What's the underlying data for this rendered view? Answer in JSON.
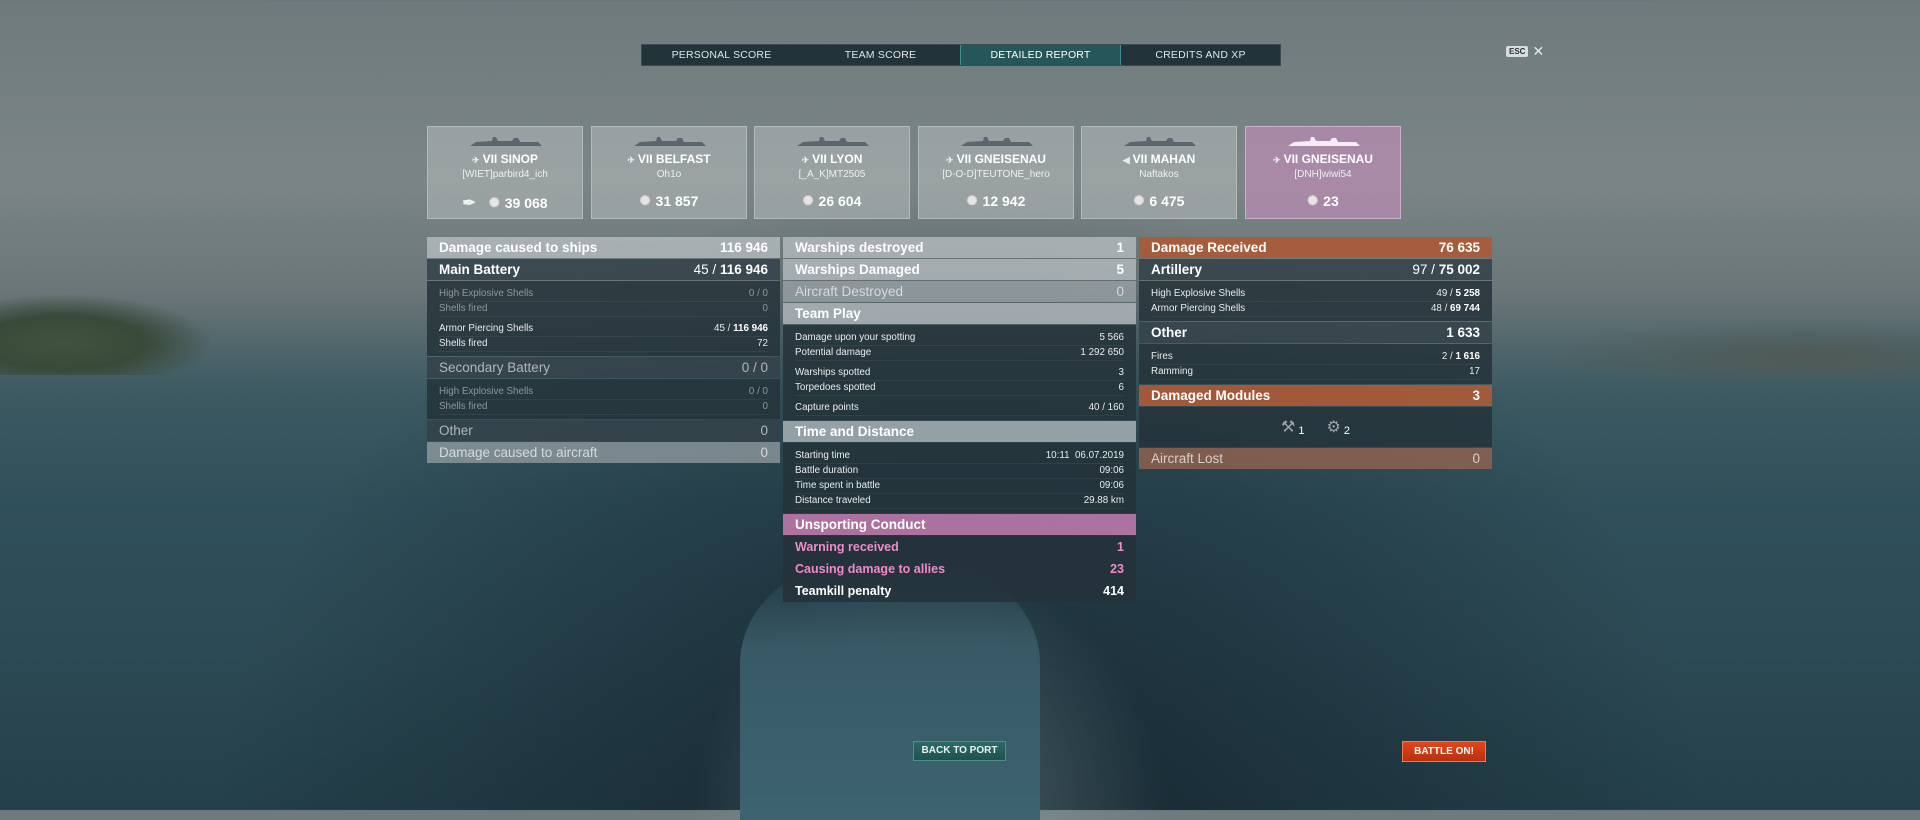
{
  "tabs": [
    {
      "label": "PERSONAL SCORE"
    },
    {
      "label": "TEAM SCORE"
    },
    {
      "label": "DETAILED REPORT"
    },
    {
      "label": "CREDITS AND XP"
    }
  ],
  "esc": {
    "key": "ESC",
    "close": "✕"
  },
  "ships": [
    {
      "tier_name": "VII SINOP",
      "player": "[WIET]parbird4_ich",
      "score": "39 068",
      "nation": "✈"
    },
    {
      "tier_name": "VII BELFAST",
      "player": "Oh1o",
      "score": "31 857",
      "nation": "✈"
    },
    {
      "tier_name": "VII LYON",
      "player": "[_A_K]MT2505",
      "score": "26 604",
      "nation": "✈"
    },
    {
      "tier_name": "VII GNEISENAU",
      "player": "[D-O-D]TEUTONE_hero",
      "score": "12 942",
      "nation": "✈"
    },
    {
      "tier_name": "VII MAHAN",
      "player": "Naftakos",
      "score": "6 475",
      "nation": "◀"
    },
    {
      "tier_name": "VII GNEISENAU",
      "player": "[DNH]wiwi54",
      "score": "23",
      "nation": "✈"
    }
  ],
  "left": {
    "damage_ships": {
      "label": "Damage caused to ships",
      "value": "116 946"
    },
    "main_battery": {
      "label": "Main Battery",
      "hits": "45 /",
      "value": "116 946"
    },
    "mb_he": {
      "label": "High Explosive Shells",
      "value": "0 / 0"
    },
    "mb_he_fired": {
      "label": "Shells fired",
      "value": "0"
    },
    "mb_ap": {
      "label": "Armor Piercing Shells",
      "hits": "45 /",
      "value": "116 946"
    },
    "mb_ap_fired": {
      "label": "Shells fired",
      "value": "72"
    },
    "secondary": {
      "label": "Secondary Battery",
      "value": "0 / 0"
    },
    "sec_he": {
      "label": "High Explosive Shells",
      "value": "0 / 0"
    },
    "sec_he_fired": {
      "label": "Shells fired",
      "value": "0"
    },
    "other": {
      "label": "Other",
      "value": "0"
    },
    "damage_aircraft": {
      "label": "Damage caused to aircraft",
      "value": "0"
    }
  },
  "middle": {
    "warships_destroyed": {
      "label": "Warships destroyed",
      "value": "1"
    },
    "warships_damaged": {
      "label": "Warships Damaged",
      "value": "5"
    },
    "aircraft_destroyed": {
      "label": "Aircraft Destroyed",
      "value": "0"
    },
    "team_play": {
      "label": "Team Play"
    },
    "spotting_damage": {
      "label": "Damage upon your spotting",
      "value": "5 566"
    },
    "potential_damage": {
      "label": "Potential damage",
      "value": "1 292 650"
    },
    "warships_spotted": {
      "label": "Warships spotted",
      "value": "3"
    },
    "torpedoes_spotted": {
      "label": "Torpedoes spotted",
      "value": "6"
    },
    "capture_points": {
      "label": "Capture points",
      "value": "40 / 160"
    },
    "time_distance": {
      "label": "Time and Distance"
    },
    "starting_time": {
      "label": "Starting time",
      "value": "10:11  06.07.2019"
    },
    "battle_duration": {
      "label": "Battle duration",
      "value": "09:06"
    },
    "time_spent": {
      "label": "Time spent in battle",
      "value": "09:06"
    },
    "distance": {
      "label": "Distance traveled",
      "value": "29.88 km"
    },
    "unsporting": {
      "label": "Unsporting Conduct"
    },
    "warning": {
      "label": "Warning received",
      "value": "1"
    },
    "damage_allies": {
      "label": "Causing damage to allies",
      "value": "23"
    },
    "teamkill": {
      "label": "Teamkill penalty",
      "value": "414"
    }
  },
  "right": {
    "damage_received": {
      "label": "Damage Received",
      "value": "76 635"
    },
    "artillery": {
      "label": "Artillery",
      "hits": "97 /",
      "value": "75 002"
    },
    "art_he": {
      "label": "High Explosive Shells",
      "hits": "49 /",
      "value": "5 258"
    },
    "art_ap": {
      "label": "Armor Piercing Shells",
      "hits": "48 /",
      "value": "69 744"
    },
    "other": {
      "label": "Other",
      "value": "1 633"
    },
    "fires": {
      "label": "Fires",
      "hits": "2 /",
      "value": "1 616"
    },
    "ramming": {
      "label": "Ramming",
      "value": "17"
    },
    "damaged_modules": {
      "label": "Damaged Modules",
      "value": "3"
    },
    "modules": [
      {
        "icon": "turret-module-icon",
        "count": "1"
      },
      {
        "icon": "engine-module-icon",
        "count": "2"
      }
    ],
    "aircraft_lost": {
      "label": "Aircraft Lost",
      "value": "0"
    }
  },
  "buttons": {
    "back_to_port": "BACK TO PORT",
    "battle_on": "BATTLE ON!"
  }
}
